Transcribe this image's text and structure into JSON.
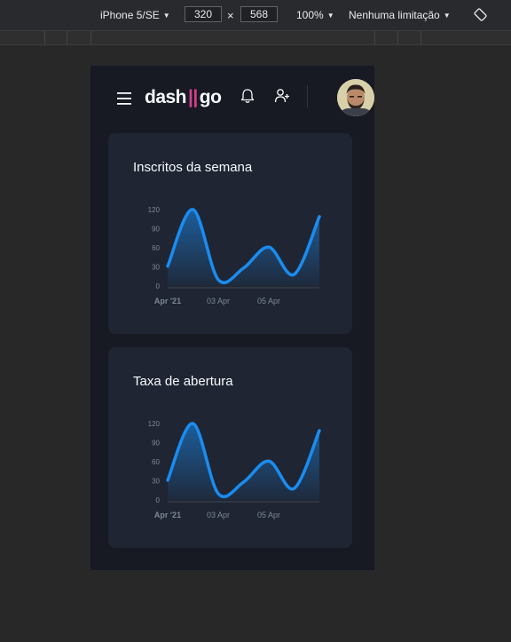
{
  "devtools": {
    "device": "iPhone 5/SE",
    "width": "320",
    "height": "568",
    "x_symbol": "×",
    "zoom": "100%",
    "throttling": "Nenhuma limitação"
  },
  "header": {
    "logo_left": "dash",
    "logo_sep": "||",
    "logo_right": "go",
    "icons": [
      "menu-icon",
      "bell-icon",
      "add-user-icon",
      "avatar"
    ]
  },
  "colors": {
    "accent": "#d53f8c",
    "line": "#1a8cf0",
    "card": "#1f2533",
    "page": "#171923"
  },
  "charts": [
    {
      "title": "Inscritos da semana",
      "chart_data": {
        "type": "area",
        "x_ticks": [
          "Apr '21",
          "03 Apr",
          "05 Apr"
        ],
        "y_ticks": [
          "120",
          "90",
          "60",
          "30",
          "0"
        ],
        "ylim": [
          0,
          120
        ],
        "x": [
          "2021-04-01",
          "2021-04-02",
          "2021-04-03",
          "2021-04-04",
          "2021-04-05",
          "2021-04-06",
          "2021-04-07"
        ],
        "series": [
          {
            "values": [
              31,
              120,
              10,
              28,
              61,
              18,
              109
            ]
          }
        ],
        "grid": false
      }
    },
    {
      "title": "Taxa de abertura",
      "chart_data": {
        "type": "area",
        "x_ticks": [
          "Apr '21",
          "03 Apr",
          "05 Apr"
        ],
        "y_ticks": [
          "120",
          "90",
          "60",
          "30",
          "0"
        ],
        "ylim": [
          0,
          120
        ],
        "x": [
          "2021-04-01",
          "2021-04-02",
          "2021-04-03",
          "2021-04-04",
          "2021-04-05",
          "2021-04-06",
          "2021-04-07"
        ],
        "series": [
          {
            "values": [
              31,
              120,
              10,
              28,
              61,
              18,
              109
            ]
          }
        ],
        "grid": false
      }
    }
  ]
}
